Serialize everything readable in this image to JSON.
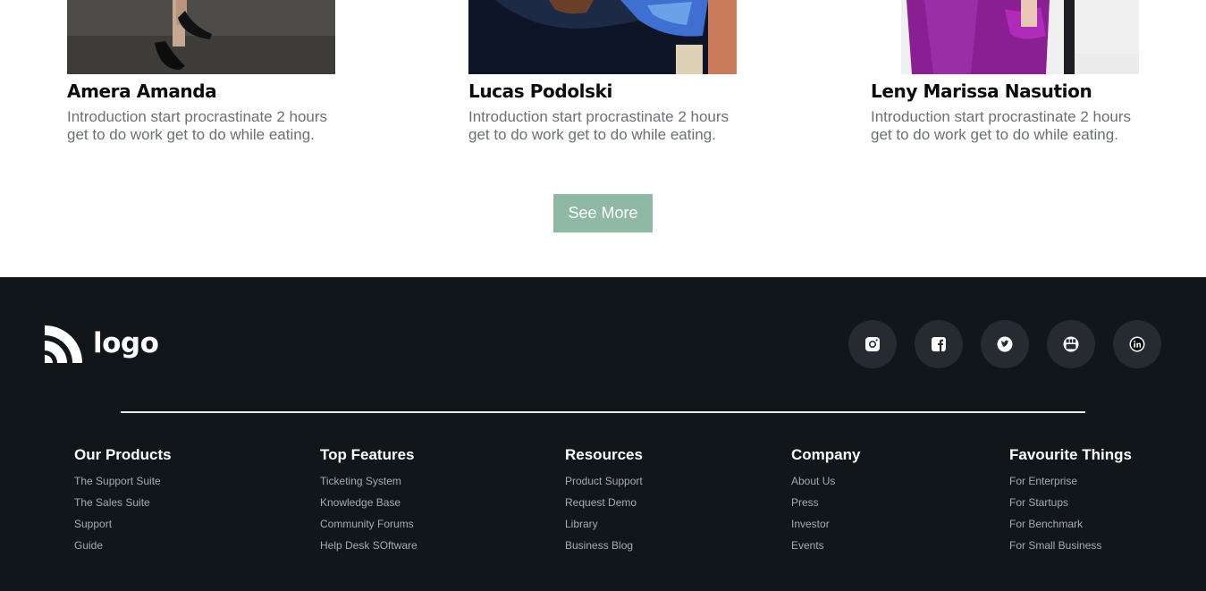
{
  "team": {
    "members": [
      {
        "name": "Amera Amanda",
        "description": "Introduction start procrastinate 2 hours get to do work get to do while eating."
      },
      {
        "name": "Lucas Podolski",
        "description": "Introduction start procrastinate 2 hours get to do work get to do while eating."
      },
      {
        "name": "Leny Marissa Nasution",
        "description": "Introduction start procrastinate 2 hours get to do work get to do while eating."
      }
    ],
    "see_more_label": "See More",
    "accent_color": "#8fb9a4"
  },
  "footer": {
    "background": "#11161b",
    "logo_text": "logo",
    "social_icons": [
      "instagram-icon",
      "facebook-icon",
      "twitter-icon",
      "youtube-icon",
      "linkedin-icon"
    ],
    "columns": [
      {
        "title": "Our Products",
        "links": [
          "The Support Suite",
          "The Sales Suite",
          "Support",
          "Guide"
        ]
      },
      {
        "title": "Top Features",
        "links": [
          "Ticketing System",
          "Knowledge Base",
          "Community Forums",
          "Help Desk SOftware"
        ]
      },
      {
        "title": "Resources",
        "links": [
          "Product Support",
          "Request Demo",
          "Library",
          "Business Blog"
        ]
      },
      {
        "title": "Company",
        "links": [
          "About Us",
          "Press",
          "Investor",
          "Events"
        ]
      },
      {
        "title": "Favourite Things",
        "links": [
          "For Enterprise",
          "For Startups",
          "For Benchmark",
          "For Small Business"
        ]
      }
    ]
  }
}
